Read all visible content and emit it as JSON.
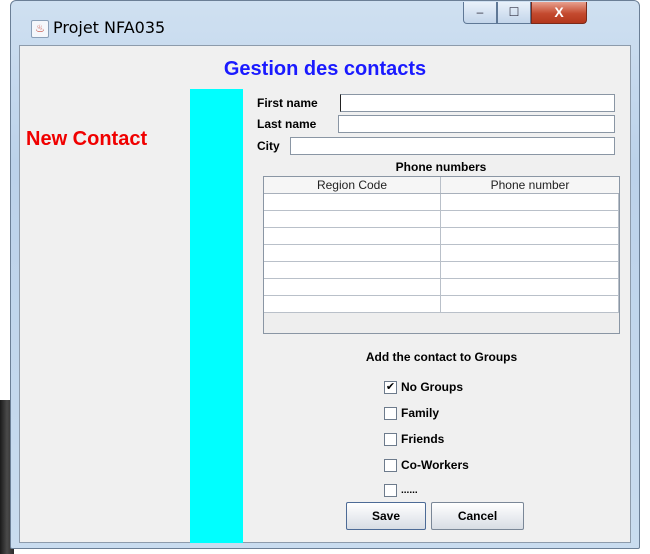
{
  "window": {
    "title": "Projet NFA035",
    "app_icon": "java-cup-icon",
    "controls": {
      "minimize": "–",
      "maximize": "☐",
      "close": "X"
    }
  },
  "header": {
    "title": "Gestion des contacts"
  },
  "side_panel": {
    "label": "New Contact",
    "accent_color": "#00ffff",
    "label_color": "#f00000"
  },
  "form": {
    "first_name": {
      "label": "First name",
      "value": ""
    },
    "last_name": {
      "label": "Last name",
      "value": ""
    },
    "city": {
      "label": "City",
      "value": ""
    }
  },
  "phones": {
    "title": "Phone numbers",
    "columns": [
      "Region Code",
      "Phone number"
    ],
    "rows": [
      [
        "",
        ""
      ],
      [
        "",
        ""
      ],
      [
        "",
        ""
      ],
      [
        "",
        ""
      ],
      [
        "",
        ""
      ],
      [
        "",
        ""
      ],
      [
        "",
        ""
      ]
    ]
  },
  "groups": {
    "title": "Add the contact to Groups",
    "items": [
      {
        "label": "No Groups",
        "checked": true
      },
      {
        "label": "Family",
        "checked": false
      },
      {
        "label": "Friends",
        "checked": false
      },
      {
        "label": "Co-Workers",
        "checked": false
      },
      {
        "label": "......",
        "checked": false
      }
    ]
  },
  "actions": {
    "save": "Save",
    "cancel": "Cancel"
  },
  "colors": {
    "title_blue": "#1a1aff",
    "close_red": "#c44a2f"
  }
}
